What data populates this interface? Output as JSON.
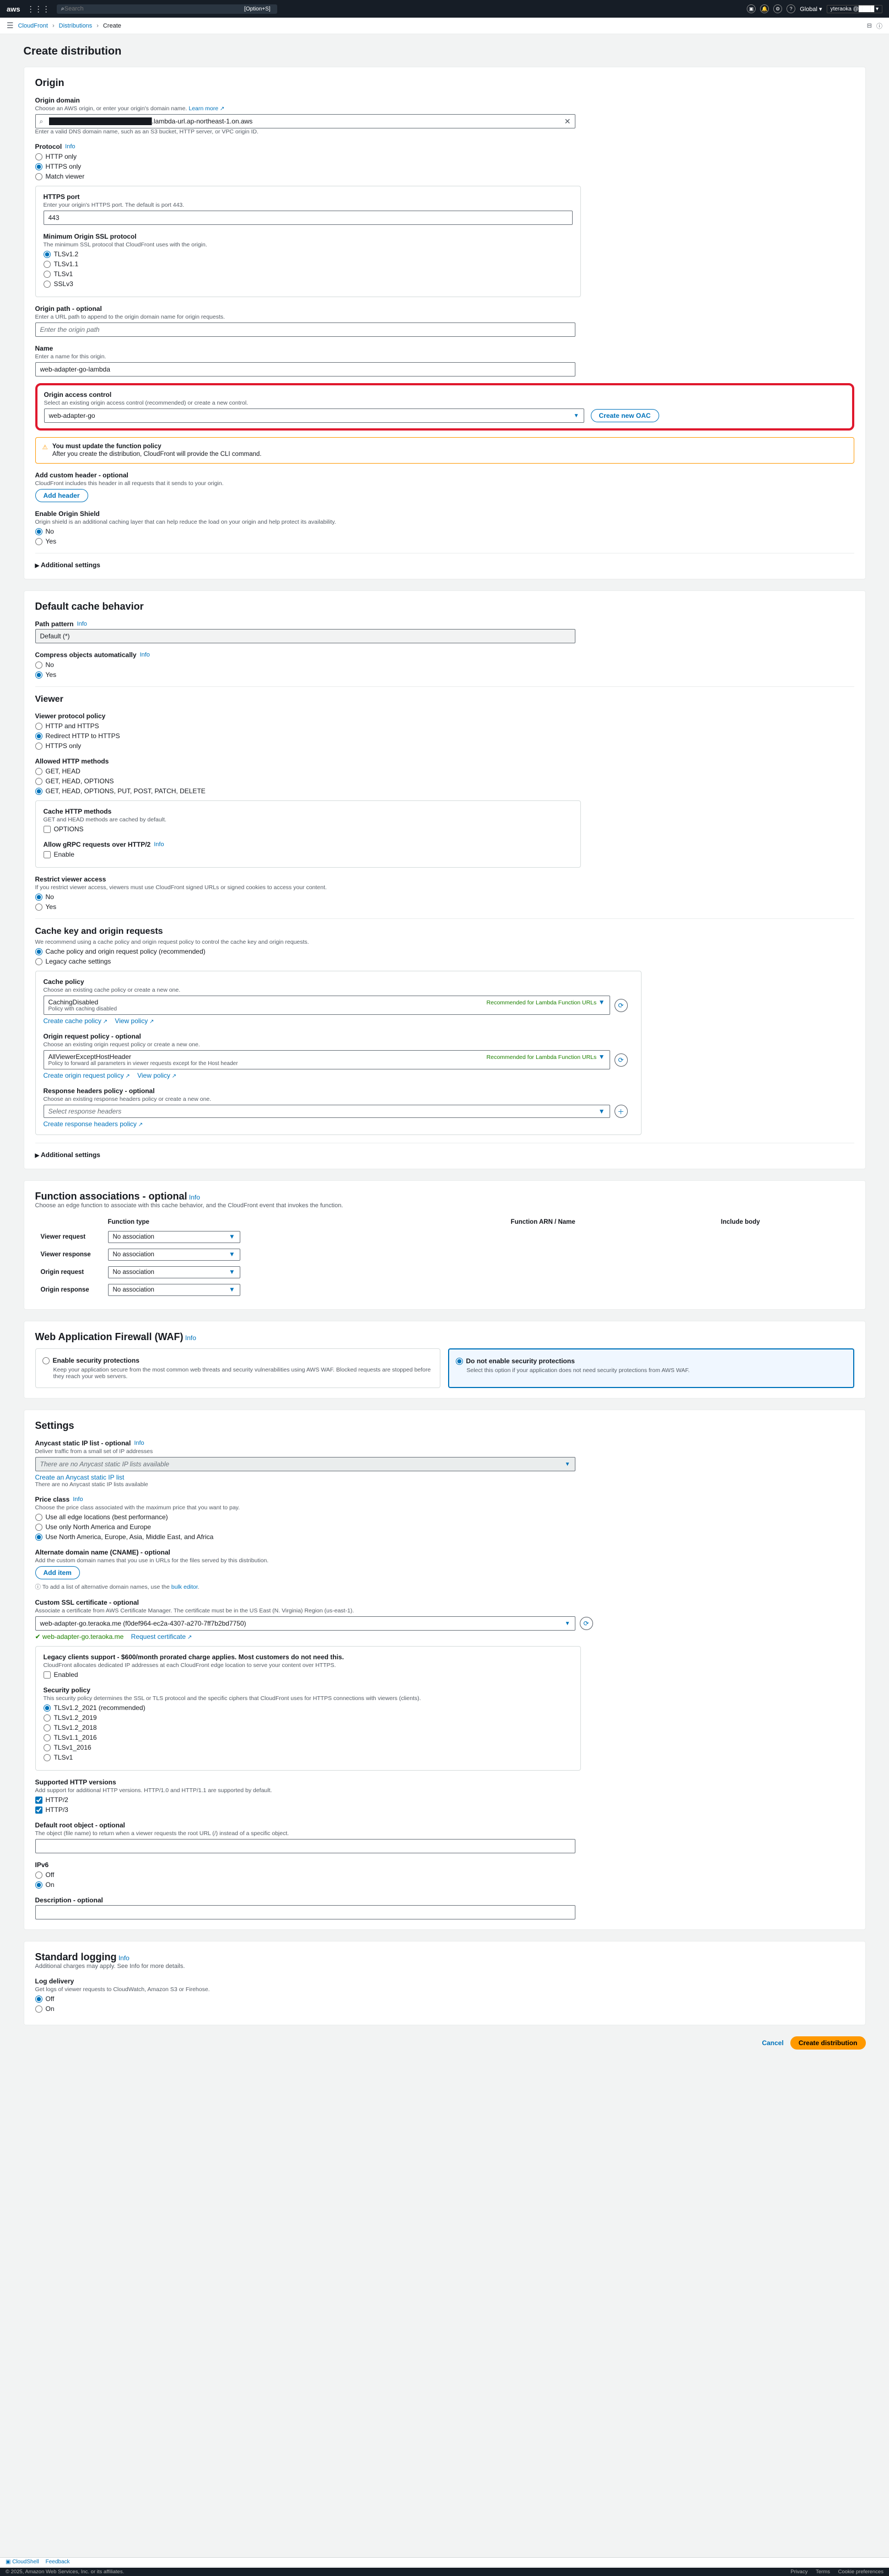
{
  "header": {
    "search_placeholder": "Search",
    "kbd_hint": "[Option+S]",
    "region": "Global ▾",
    "user": "yteraoka @"
  },
  "breadcrumbs": {
    "a": "CloudFront",
    "b": "Distributions",
    "c": "Create"
  },
  "page_title": "Create distribution",
  "origin": {
    "heading": "Origin",
    "domain_label": "Origin domain",
    "domain_desc": "Choose an AWS origin, or enter your origin's domain name.",
    "learn_more": "Learn more",
    "domain_value": "██████████████████████.lambda-url.ap-northeast-1.on.aws",
    "domain_hint": "Enter a valid DNS domain name, such as an S3 bucket, HTTP server, or VPC origin ID.",
    "protocol_label": "Protocol",
    "info": "Info",
    "protocol_opts": [
      "HTTP only",
      "HTTPS only",
      "Match viewer"
    ],
    "https_port_label": "HTTPS port",
    "https_port_desc": "Enter your origin's HTTPS port. The default is port 443.",
    "https_port_value": "443",
    "min_ssl_label": "Minimum Origin SSL protocol",
    "min_ssl_desc": "The minimum SSL protocol that CloudFront uses with the origin.",
    "min_ssl_opts": [
      "TLSv1.2",
      "TLSv1.1",
      "TLSv1",
      "SSLv3"
    ],
    "origin_path_label": "Origin path - optional",
    "origin_path_desc": "Enter a URL path to append to the origin domain name for origin requests.",
    "origin_path_ph": "Enter the origin path",
    "name_label": "Name",
    "name_desc": "Enter a name for this origin.",
    "name_value": "web-adapter-go-lambda",
    "oac_label": "Origin access control",
    "oac_desc": "Select an existing origin access control (recommended) or create a new control.",
    "oac_value": "web-adapter-go",
    "oac_create_btn": "Create new OAC",
    "oac_warn_title": "You must update the function policy",
    "oac_warn_body": "After you create the distribution, CloudFront will provide the CLI command.",
    "custom_header_label": "Add custom header - optional",
    "custom_header_desc": "CloudFront includes this header in all requests that it sends to your origin.",
    "add_header_btn": "Add header",
    "shield_label": "Enable Origin Shield",
    "shield_desc": "Origin shield is an additional caching layer that can help reduce the load on your origin and help protect its availability.",
    "no": "No",
    "yes": "Yes",
    "additional": "Additional settings"
  },
  "cache": {
    "heading": "Default cache behavior",
    "path_label": "Path pattern",
    "path_value": "Default (*)",
    "compress_label": "Compress objects automatically",
    "viewer_heading": "Viewer",
    "vpp_label": "Viewer protocol policy",
    "vpp_opts": [
      "HTTP and HTTPS",
      "Redirect HTTP to HTTPS",
      "HTTPS only"
    ],
    "methods_label": "Allowed HTTP methods",
    "methods_opts": [
      "GET, HEAD",
      "GET, HEAD, OPTIONS",
      "GET, HEAD, OPTIONS, PUT, POST, PATCH, DELETE"
    ],
    "cache_methods_label": "Cache HTTP methods",
    "cache_methods_desc": "GET and HEAD methods are cached by default.",
    "cache_methods_opt": "OPTIONS",
    "grpc_label": "Allow gRPC requests over HTTP/2",
    "grpc_opt": "Enable",
    "restrict_label": "Restrict viewer access",
    "restrict_desc": "If you restrict viewer access, viewers must use CloudFront signed URLs or signed cookies to access your content.",
    "ckor_heading": "Cache key and origin requests",
    "ckor_desc": "We recommend using a cache policy and origin request policy to control the cache key and origin requests.",
    "ckor_opts": [
      "Cache policy and origin request policy (recommended)",
      "Legacy cache settings"
    ],
    "cache_policy_label": "Cache policy",
    "cache_policy_desc": "Choose an existing cache policy or create a new one.",
    "cache_policy_val": "CachingDisabled",
    "cache_policy_sub": "Policy with caching disabled",
    "recommended_txt": "Recommended for Lambda Function URLs",
    "create_cache_policy": "Create cache policy",
    "view_policy": "View policy",
    "orp_label": "Origin request policy - optional",
    "orp_desc": "Choose an existing origin request policy or create a new one.",
    "orp_val": "AllViewerExceptHostHeader",
    "orp_sub": "Policy to forward all parameters in viewer requests except for the Host header",
    "create_orp": "Create origin request policy",
    "rhp_label": "Response headers policy - optional",
    "rhp_desc": "Choose an existing response headers policy or create a new one.",
    "rhp_ph": "Select response headers",
    "create_rhp": "Create response headers policy",
    "additional": "Additional settings"
  },
  "func": {
    "heading": "Function associations - optional",
    "desc": "Choose an edge function to associate with this cache behavior, and the CloudFront event that invokes the function.",
    "col1": "Function type",
    "col2": "Function ARN / Name",
    "col3": "Include body",
    "rows": [
      "Viewer request",
      "Viewer response",
      "Origin request",
      "Origin response"
    ],
    "no_assoc": "No association"
  },
  "waf": {
    "heading": "Web Application Firewall (WAF)",
    "opt1_title": "Enable security protections",
    "opt1_body": "Keep your application secure from the most common web threats and security vulnerabilities using AWS WAF. Blocked requests are stopped before they reach your web servers.",
    "opt2_title": "Do not enable security protections",
    "opt2_body": "Select this option if your application does not need security protections from AWS WAF."
  },
  "settings": {
    "heading": "Settings",
    "anycast_label": "Anycast static IP list - optional",
    "anycast_desc": "Deliver traffic from a small set of IP addresses",
    "anycast_ph": "There are no Anycast static IP lists available",
    "anycast_create": "Create an Anycast static IP list",
    "anycast_none": "There are no Anycast static IP lists available",
    "price_label": "Price class",
    "price_desc": "Choose the price class associated with the maximum price that you want to pay.",
    "price_opts": [
      "Use all edge locations (best performance)",
      "Use only North America and Europe",
      "Use North America, Europe, Asia, Middle East, and Africa"
    ],
    "cname_label": "Alternate domain name (CNAME) - optional",
    "cname_desc": "Add the custom domain names that you use in URLs for the files served by this distribution.",
    "add_item_btn": "Add item",
    "cname_hint_a": "To add a list of alternative domain names, use the ",
    "cname_hint_b": "bulk editor",
    "ssl_label": "Custom SSL certificate - optional",
    "ssl_desc": "Associate a certificate from AWS Certificate Manager. The certificate must be in the US East (N. Virginia) Region (us-east-1).",
    "ssl_val": "web-adapter-go.teraoka.me (f0def964-ec2a-4307-a270-7ff7b2bd7750)",
    "ssl_link": "web-adapter-go.teraoka.me",
    "ssl_req": "Request certificate",
    "legacy_title": "Legacy clients support - $600/month prorated charge applies. Most customers do not need this.",
    "legacy_body": "CloudFront allocates dedicated IP addresses at each CloudFront edge location to serve your content over HTTPS.",
    "legacy_opt": "Enabled",
    "secpol_label": "Security policy",
    "secpol_desc": "This security policy determines the SSL or TLS protocol and the specific ciphers that CloudFront uses for HTTPS connections with viewers (clients).",
    "secpol_opts": [
      "TLSv1.2_2021 (recommended)",
      "TLSv1.2_2019",
      "TLSv1.2_2018",
      "TLSv1.1_2016",
      "TLSv1_2016",
      "TLSv1"
    ],
    "httpver_label": "Supported HTTP versions",
    "httpver_desc": "Add support for additional HTTP versions. HTTP/1.0 and HTTP/1.1 are supported by default.",
    "httpver_opts": [
      "HTTP/2",
      "HTTP/3"
    ],
    "root_label": "Default root object - optional",
    "root_desc": "The object (file name) to return when a viewer requests the root URL (/) instead of a specific object.",
    "ipv6_label": "IPv6",
    "off": "Off",
    "on": "On",
    "desc_label": "Description - optional"
  },
  "logging": {
    "heading": "Standard logging",
    "desc": "Additional charges may apply. See Info for more details.",
    "delivery_label": "Log delivery",
    "delivery_desc": "Get logs of viewer requests to CloudWatch, Amazon S3 or Firehose."
  },
  "actions": {
    "cancel": "Cancel",
    "create": "Create distribution"
  },
  "bottombar": {
    "cloudshell": "CloudShell",
    "feedback": "Feedback"
  },
  "legal": {
    "copyright": "© 2025, Amazon Web Services, Inc. or its affiliates.",
    "privacy": "Privacy",
    "terms": "Terms",
    "cookie": "Cookie preferences"
  },
  "info": "Info"
}
